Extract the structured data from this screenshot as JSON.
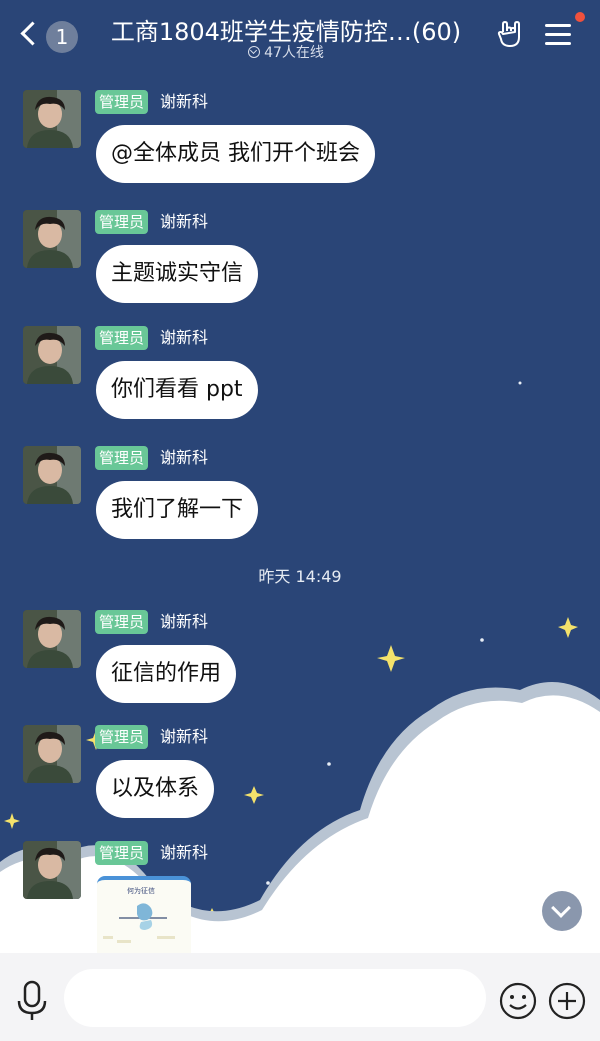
{
  "header": {
    "back_badge": "1",
    "title": "工商1804班学生疫情防控…(60)",
    "online": "47人在线"
  },
  "messages": [
    {
      "tag": "管理员",
      "sender": "谢新科",
      "text": "@全体成员 我们开个班会"
    },
    {
      "tag": "管理员",
      "sender": "谢新科",
      "text": "主题诚实守信"
    },
    {
      "tag": "管理员",
      "sender": "谢新科",
      "text": "你们看看 ppt"
    },
    {
      "tag": "管理员",
      "sender": "谢新科",
      "text": "我们了解一下"
    },
    {
      "tag": "管理员",
      "sender": "谢新科",
      "text": "征信的作用"
    },
    {
      "tag": "管理员",
      "sender": "谢新科",
      "text": "以及体系"
    },
    {
      "tag": "管理员",
      "sender": "谢新科",
      "image_caption": "何为征信"
    }
  ],
  "timestamp": "昨天 14:49",
  "input": {
    "icons": [
      "microphone-icon",
      "emoji-icon",
      "plus-icon"
    ]
  },
  "colors": {
    "background": "#2a4577",
    "admin_tag": "#69c797",
    "unread_dot": "#f0513d"
  }
}
